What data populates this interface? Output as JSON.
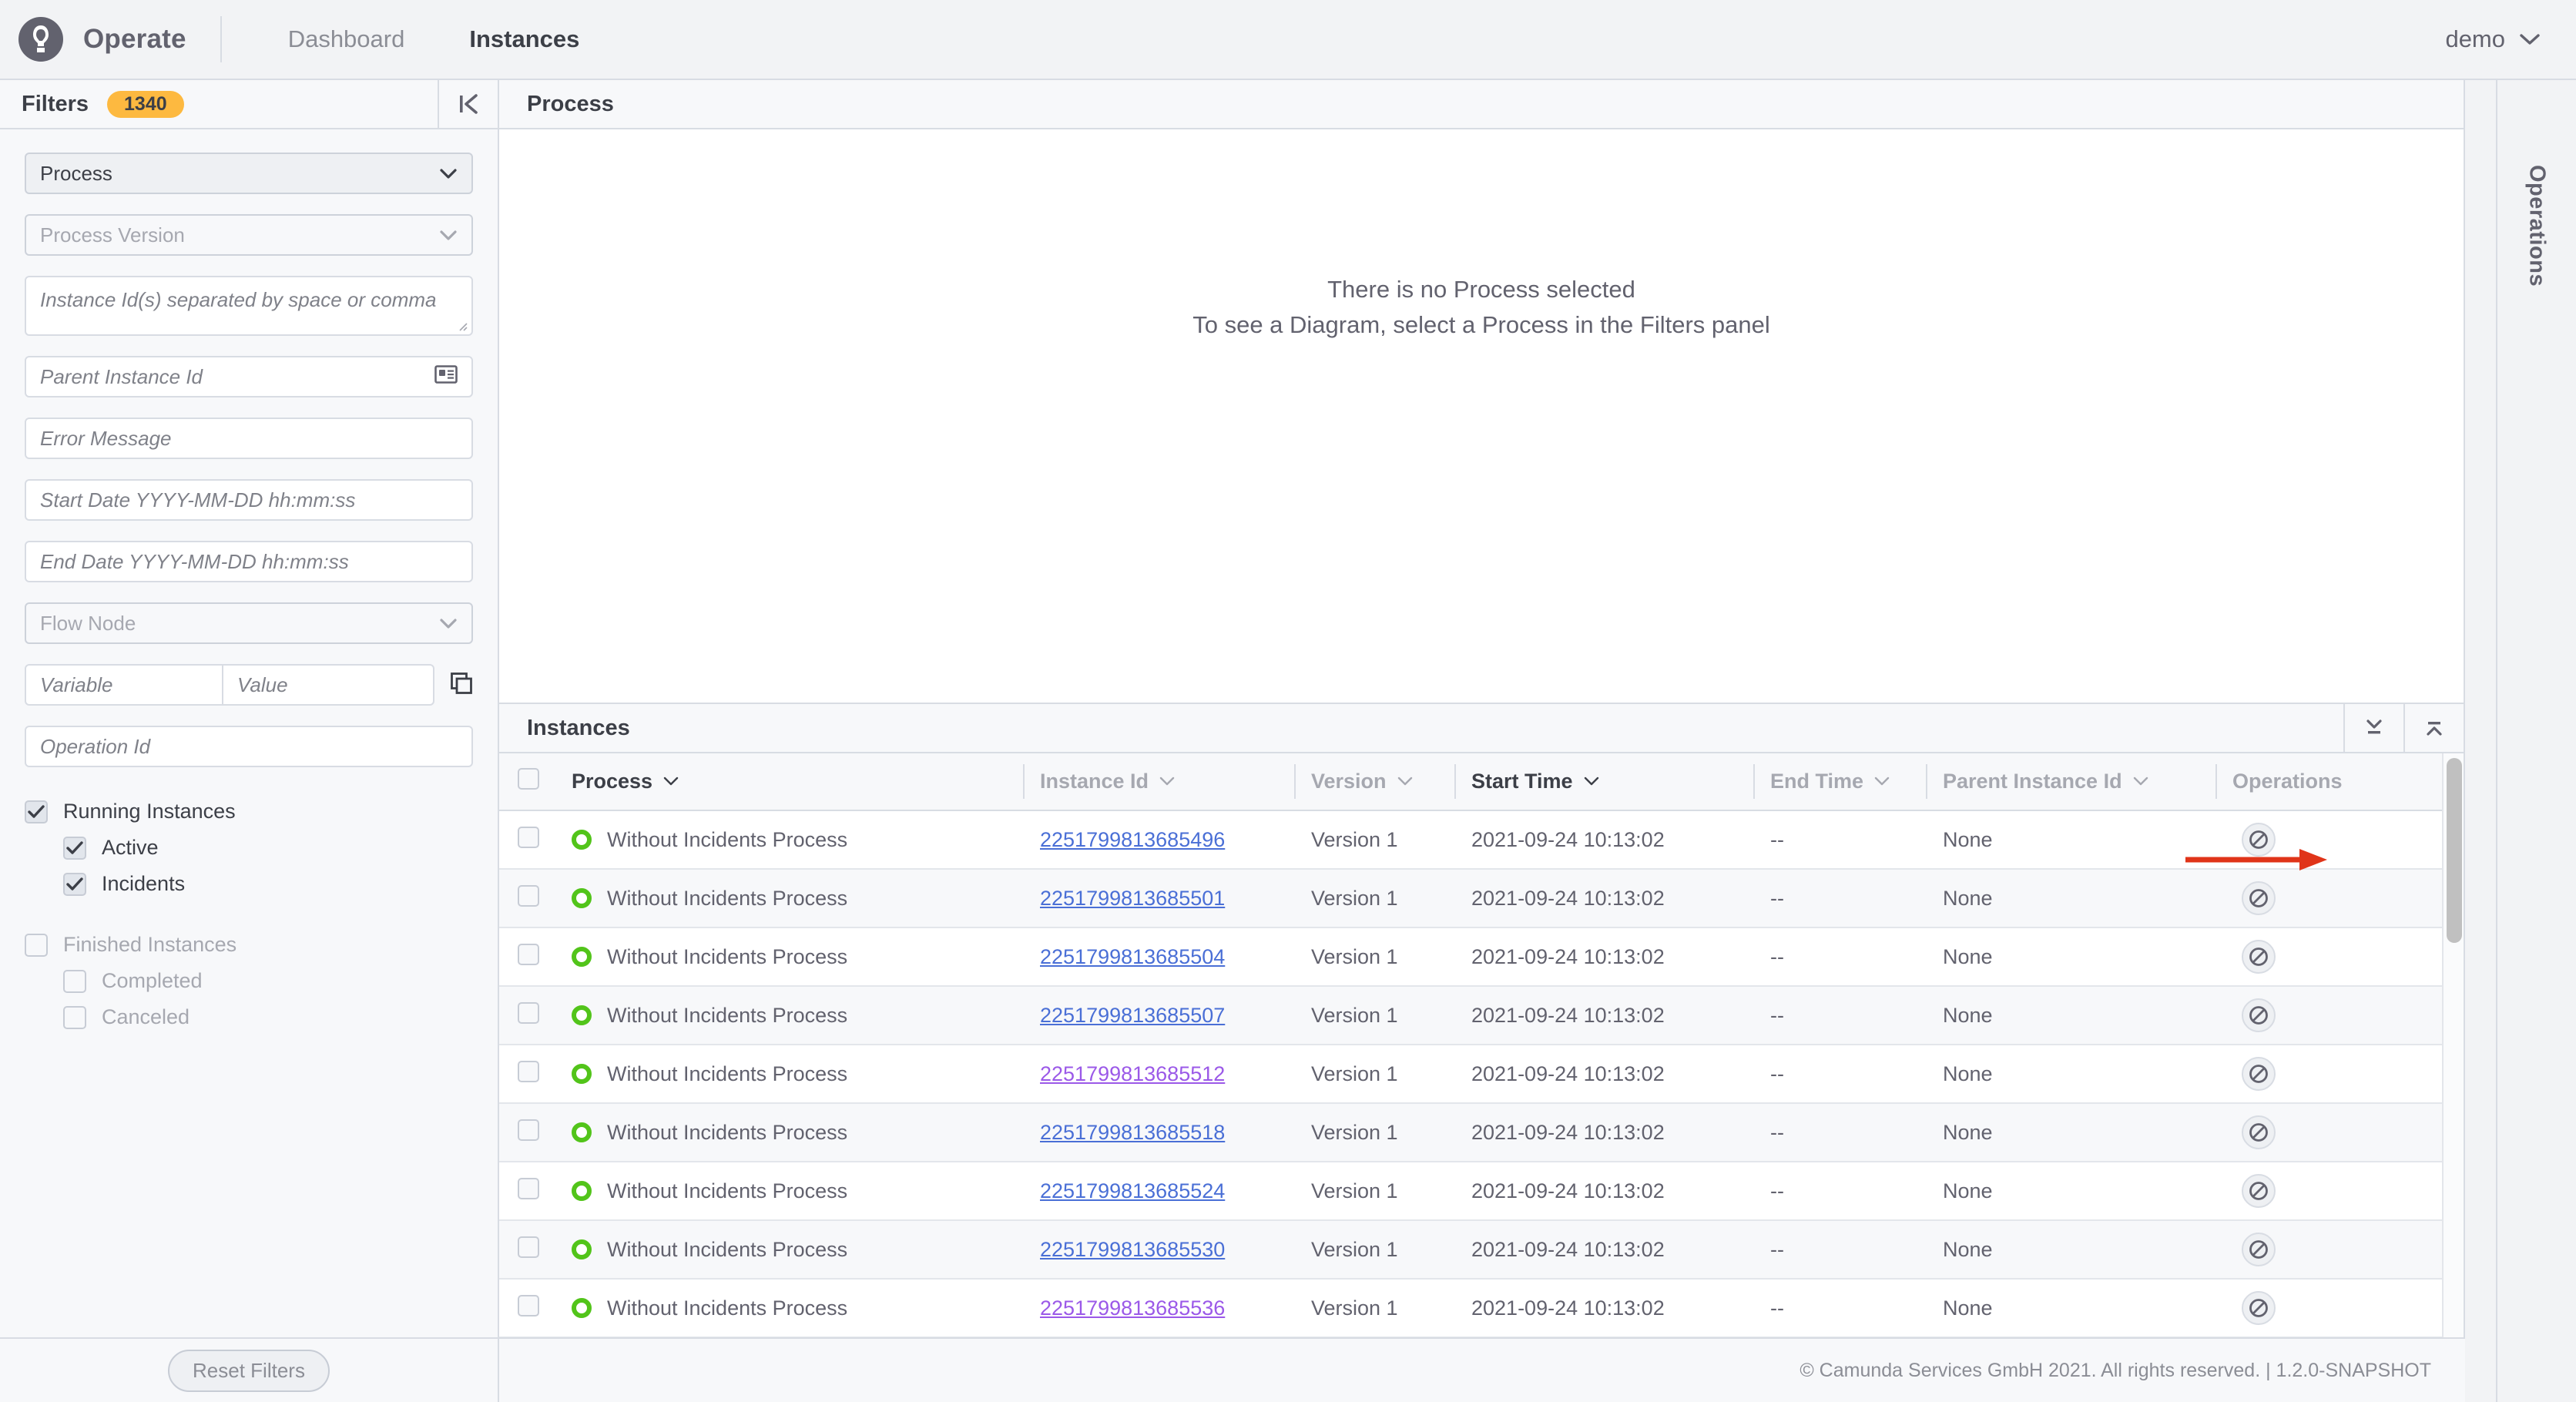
{
  "header": {
    "brand": "Operate",
    "logo_icon": "camunda-logo-icon",
    "nav": [
      {
        "label": "Dashboard",
        "active": false
      },
      {
        "label": "Instances",
        "active": true
      }
    ],
    "user": "demo",
    "user_chevron_icon": "chevron-down-icon"
  },
  "filters": {
    "title": "Filters",
    "count_badge": "1340",
    "badge_color": "#fdb940",
    "collapse_icon": "collapse-left-icon",
    "process_select": {
      "value": "Process",
      "icon": "chevron-down-icon"
    },
    "process_version_select": {
      "placeholder": "Process Version",
      "icon": "chevron-down-icon"
    },
    "instance_ids": {
      "placeholder": "Instance Id(s) separated by space or comma"
    },
    "parent_instance_id": {
      "placeholder": "Parent Instance Id",
      "icon": "id-card-icon"
    },
    "error_message": {
      "placeholder": "Error Message"
    },
    "start_date": {
      "placeholder": "Start Date YYYY-MM-DD hh:mm:ss"
    },
    "end_date": {
      "placeholder": "End Date YYYY-MM-DD hh:mm:ss"
    },
    "flow_node_select": {
      "placeholder": "Flow Node",
      "icon": "chevron-down-icon"
    },
    "variable": {
      "placeholder": "Variable"
    },
    "value": {
      "placeholder": "Value"
    },
    "variable_copy_icon": "copy-icon",
    "operation_id": {
      "placeholder": "Operation Id"
    },
    "checkboxes": [
      {
        "label": "Running Instances",
        "checked": true,
        "indent": false,
        "muted": false
      },
      {
        "label": "Active",
        "checked": true,
        "indent": true,
        "muted": false
      },
      {
        "label": "Incidents",
        "checked": true,
        "indent": true,
        "muted": false
      },
      {
        "label": "Finished Instances",
        "checked": false,
        "indent": false,
        "muted": true
      },
      {
        "label": "Completed",
        "checked": false,
        "indent": true,
        "muted": true
      },
      {
        "label": "Canceled",
        "checked": false,
        "indent": true,
        "muted": true
      }
    ],
    "reset_button": "Reset Filters"
  },
  "process_panel": {
    "title": "Process",
    "empty_line_1": "There is no Process selected",
    "empty_line_2": "To see a Diagram, select a Process in the Filters panel"
  },
  "instances_panel": {
    "title": "Instances",
    "collapse_down_icon": "collapse-down-icon",
    "expand_up_icon": "expand-up-icon",
    "columns": [
      {
        "label": "Process",
        "sortable": true,
        "strong": true
      },
      {
        "label": "Instance Id",
        "sortable": true,
        "strong": false
      },
      {
        "label": "Version",
        "sortable": true,
        "strong": false
      },
      {
        "label": "Start Time",
        "sortable": true,
        "strong": true
      },
      {
        "label": "End Time",
        "sortable": true,
        "strong": false
      },
      {
        "label": "Parent Instance Id",
        "sortable": true,
        "strong": false
      },
      {
        "label": "Operations",
        "sortable": false,
        "strong": false
      }
    ],
    "rows": [
      {
        "state": "active",
        "process": "Without Incidents Process",
        "instance_id": "2251799813685496",
        "visited": false,
        "version": "Version 1",
        "start_time": "2021-09-24 10:13:02",
        "end_time": "--",
        "parent_instance_id": "None",
        "operation_icon": "cancel-operation-icon"
      },
      {
        "state": "active",
        "process": "Without Incidents Process",
        "instance_id": "2251799813685501",
        "visited": false,
        "version": "Version 1",
        "start_time": "2021-09-24 10:13:02",
        "end_time": "--",
        "parent_instance_id": "None",
        "operation_icon": "cancel-operation-icon"
      },
      {
        "state": "active",
        "process": "Without Incidents Process",
        "instance_id": "2251799813685504",
        "visited": false,
        "version": "Version 1",
        "start_time": "2021-09-24 10:13:02",
        "end_time": "--",
        "parent_instance_id": "None",
        "operation_icon": "cancel-operation-icon"
      },
      {
        "state": "active",
        "process": "Without Incidents Process",
        "instance_id": "2251799813685507",
        "visited": false,
        "version": "Version 1",
        "start_time": "2021-09-24 10:13:02",
        "end_time": "--",
        "parent_instance_id": "None",
        "operation_icon": "cancel-operation-icon"
      },
      {
        "state": "active",
        "process": "Without Incidents Process",
        "instance_id": "2251799813685512",
        "visited": true,
        "version": "Version 1",
        "start_time": "2021-09-24 10:13:02",
        "end_time": "--",
        "parent_instance_id": "None",
        "operation_icon": "cancel-operation-icon"
      },
      {
        "state": "active",
        "process": "Without Incidents Process",
        "instance_id": "2251799813685518",
        "visited": false,
        "version": "Version 1",
        "start_time": "2021-09-24 10:13:02",
        "end_time": "--",
        "parent_instance_id": "None",
        "operation_icon": "cancel-operation-icon"
      },
      {
        "state": "active",
        "process": "Without Incidents Process",
        "instance_id": "2251799813685524",
        "visited": false,
        "version": "Version 1",
        "start_time": "2021-09-24 10:13:02",
        "end_time": "--",
        "parent_instance_id": "None",
        "operation_icon": "cancel-operation-icon"
      },
      {
        "state": "active",
        "process": "Without Incidents Process",
        "instance_id": "2251799813685530",
        "visited": false,
        "version": "Version 1",
        "start_time": "2021-09-24 10:13:02",
        "end_time": "--",
        "parent_instance_id": "None",
        "operation_icon": "cancel-operation-icon"
      },
      {
        "state": "active",
        "process": "Without Incidents Process",
        "instance_id": "2251799813685536",
        "visited": true,
        "version": "Version 1",
        "start_time": "2021-09-24 10:13:02",
        "end_time": "--",
        "parent_instance_id": "None",
        "operation_icon": "cancel-operation-icon"
      }
    ]
  },
  "operations_rail": {
    "label": "Operations"
  },
  "footer": {
    "copyright": "© Camunda Services GmbH 2021. All rights reserved. | 1.2.0-SNAPSHOT"
  },
  "annotation": {
    "arrow_color": "#e03419",
    "points_to": "cancel-operation-icon-row-1"
  }
}
